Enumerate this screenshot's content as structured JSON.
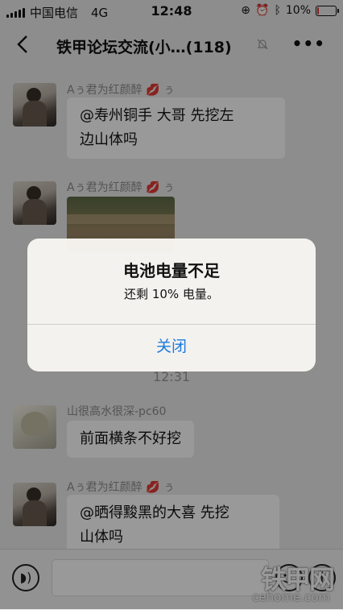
{
  "status_bar": {
    "carrier": "中国电信",
    "network": "4G",
    "time": "12:48",
    "battery_percent_text": "10%",
    "battery_level": 0.1
  },
  "nav": {
    "back_icon": "chevron-left-icon",
    "title": "铁甲论坛交流(小…(118)",
    "mute_icon": "bell-off-icon",
    "more_label": "•••"
  },
  "messages": [
    {
      "sender": "Aぅ君为红颜醉",
      "sender_suffix": "ぅ",
      "sender_emoji": "💋",
      "text_line1": "@寿州铜手 大哥 先挖左",
      "text_line2": "边山体吗"
    },
    {
      "sender": "Aぅ君为红颜醉",
      "sender_suffix": "ぅ",
      "sender_emoji": "💋",
      "type": "image"
    },
    {
      "sender": "山很高水很深-pc60",
      "text": "前面横条不好挖"
    },
    {
      "sender": "Aぅ君为红颜醉",
      "sender_suffix": "ぅ",
      "sender_emoji": "💋",
      "text_line1": "@晒得黢黑的大喜 先挖",
      "text_line2": "山体吗"
    }
  ],
  "timestamp": "12:31",
  "alert": {
    "title": "电池电量不足",
    "message": "还剩 10% 电量。",
    "button": "关闭",
    "button_color": "#1a7ae0"
  },
  "watermark": {
    "logo_text": "铁甲网",
    "site": "cehome.com"
  }
}
